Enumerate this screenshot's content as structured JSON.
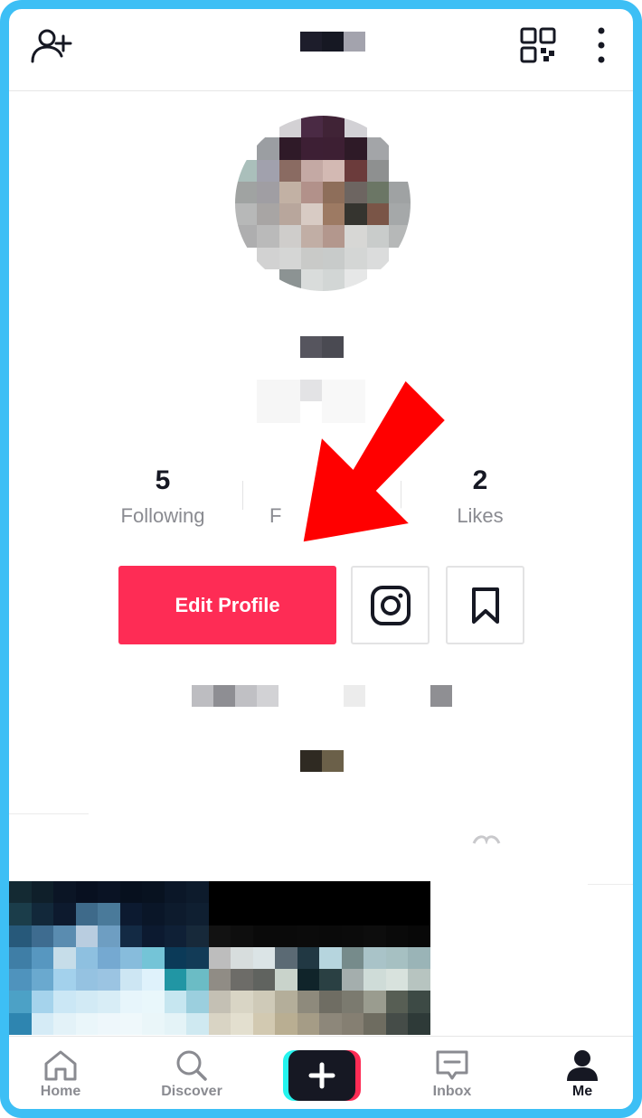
{
  "header": {
    "add_user_icon": "person-plus-icon",
    "qr_icon": "qr-code-icon",
    "more_icon": "vertical-ellipsis-icon"
  },
  "stats": [
    {
      "value": "5",
      "label": "Following"
    },
    {
      "value": "",
      "label": "F"
    },
    {
      "value": "2",
      "label": "Likes"
    }
  ],
  "actions": {
    "edit_profile_label": "Edit Profile",
    "instagram_icon": "instagram-icon",
    "bookmark_icon": "bookmark-icon"
  },
  "annotation": {
    "color": "#ff0000"
  },
  "colors": {
    "accent": "#fe2c55",
    "frame": "#3dbff5",
    "text_primary": "#161823",
    "text_secondary": "#8a8b91"
  },
  "nav": {
    "items": [
      {
        "label": "Home",
        "icon": "home-icon"
      },
      {
        "label": "Discover",
        "icon": "search-icon"
      },
      {
        "label": "",
        "icon": "plus-icon"
      },
      {
        "label": "Inbox",
        "icon": "inbox-icon"
      },
      {
        "label": "Me",
        "icon": "profile-icon"
      }
    ],
    "active": "Me"
  }
}
